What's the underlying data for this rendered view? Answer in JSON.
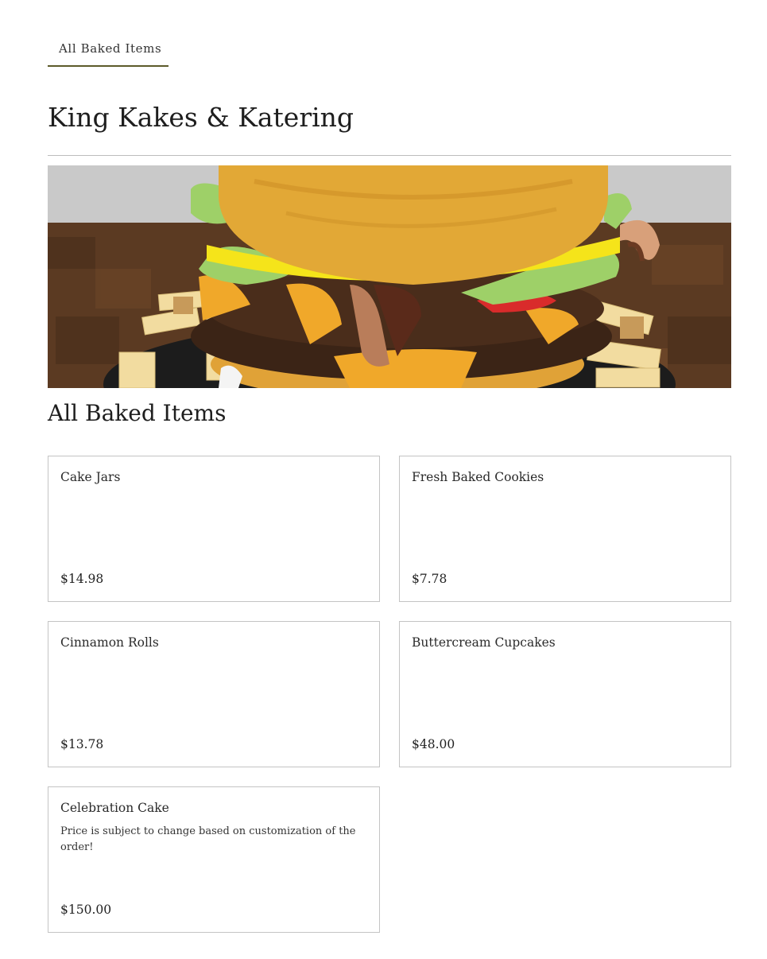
{
  "nav": {
    "tabs": [
      {
        "label": "All Baked Items",
        "active": true
      }
    ]
  },
  "page": {
    "title": "King Kakes & Katering"
  },
  "hero": {
    "image": "burger-cake-photo"
  },
  "section": {
    "title": "All Baked Items"
  },
  "items": [
    {
      "name": "Cake Jars",
      "description": "",
      "price": "$14.98"
    },
    {
      "name": "Fresh Baked Cookies",
      "description": "",
      "price": "$7.78"
    },
    {
      "name": "Cinnamon Rolls",
      "description": "",
      "price": "$13.78"
    },
    {
      "name": "Buttercream Cupcakes",
      "description": "",
      "price": "$48.00"
    },
    {
      "name": "Celebration Cake",
      "description": "Price is subject to change based on customization of the order!",
      "price": "$150.00"
    }
  ],
  "colors": {
    "tab_underline": "#5c5a2a",
    "card_border": "#c4c4c4",
    "divider": "#bdbdbd"
  }
}
